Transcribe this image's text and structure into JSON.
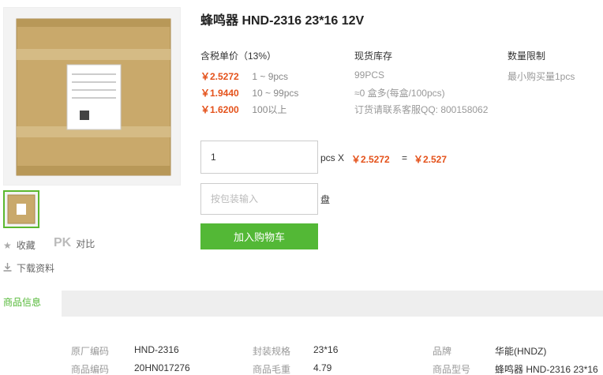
{
  "product": {
    "title": "蜂鸣器 HND-2316 23*16 12V"
  },
  "gallery": {
    "main_alt": "product-box-photo",
    "thumb_alt": "product-box-thumbnail"
  },
  "actions": {
    "favorite_label": "收藏",
    "pk_label": "PK",
    "compare_label": "对比",
    "download_label": "下载资料"
  },
  "pricing": {
    "header": "含税单价（13%）",
    "tiers": [
      {
        "price": "￥2.5272",
        "range": "1 ~ 9pcs"
      },
      {
        "price": "￥1.9440",
        "range": "10 ~ 99pcs"
      },
      {
        "price": "￥1.6200",
        "range": "100以上"
      }
    ]
  },
  "stock": {
    "header": "现货库存",
    "quantity": "99PCS",
    "box_info": "≈0 盒多(每盒/100pcs)",
    "contact": "订货请联系客服QQ: 800158062"
  },
  "limit": {
    "header": "数量限制",
    "text": "最小购买量1pcs"
  },
  "order": {
    "qty_value": "1",
    "qty_unit": "pcs X",
    "unit_price": "￥2.5272",
    "equals": "=",
    "total": "￥2.527",
    "pack_placeholder": "按包装输入",
    "pack_unit": "盘",
    "cart_button": "加入购物车"
  },
  "info": {
    "tab_label": "商品信息",
    "specs": [
      {
        "label": "原厂编码",
        "value": "HND-2316"
      },
      {
        "label": "封装规格",
        "value": "23*16"
      },
      {
        "label": "品牌",
        "value": "华能(HNDZ)"
      },
      {
        "label": "商品编码",
        "value": "20HN017276"
      },
      {
        "label": "商品毛重",
        "value": "4.79"
      },
      {
        "label": "商品型号",
        "value": "蜂鸣器 HND-2316 23*16 ."
      }
    ]
  },
  "colors": {
    "accent_green": "#53b836",
    "price_orange": "#e4521b"
  }
}
